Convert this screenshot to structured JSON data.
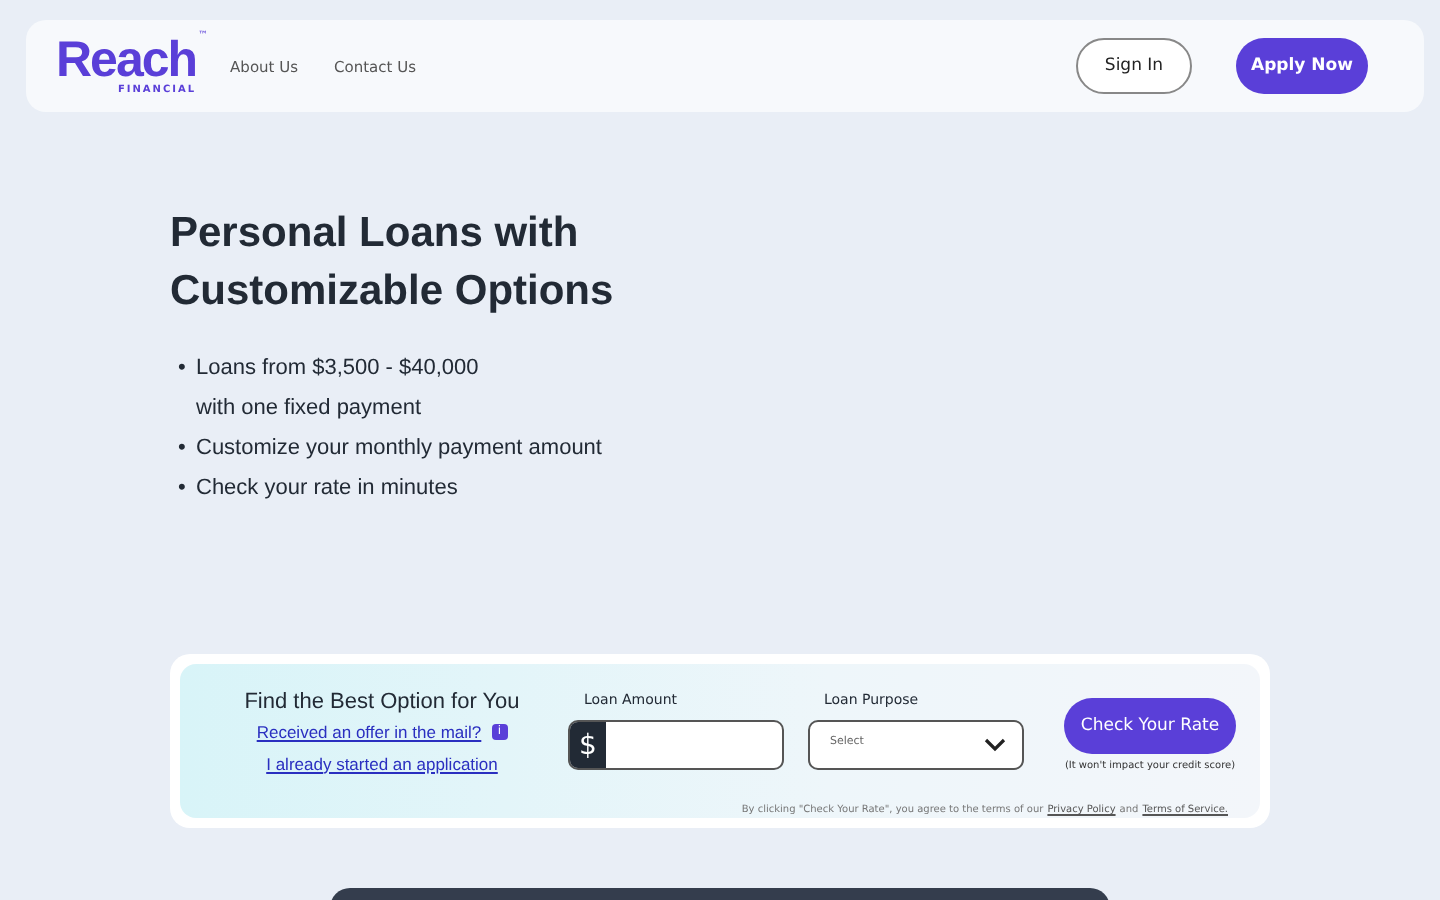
{
  "header": {
    "logo": "Reach",
    "logo_sub": "FINANCIAL",
    "logo_mark": "™",
    "nav": [
      "About Us",
      "Contact Us"
    ],
    "sign_in": "Sign In",
    "apply": "Apply Now"
  },
  "hero": {
    "title": "Personal Loans with Customizable Options",
    "bullet_mark": "•",
    "bullets": [
      "Loans from $3,500 - $40,000\nwith one fixed payment",
      "Customize your monthly payment amount",
      "Check your rate in minutes"
    ]
  },
  "form": {
    "title": "Find the Best Option for You",
    "offer_link": "Received an offer in the mail?",
    "info": "i",
    "started_link": "I already started an application",
    "amount_label": "Loan Amount",
    "currency": "$",
    "purpose_label": "Loan Purpose",
    "purpose_placeholder": "Select",
    "button": "Check Your Rate",
    "button_note": "(It won't impact your credit score)",
    "terms": "By clicking \"Check Your Rate\", you agree to the terms of our",
    "privacy": "Privacy Policy",
    "and": "and",
    "tos": "Terms of Service."
  }
}
